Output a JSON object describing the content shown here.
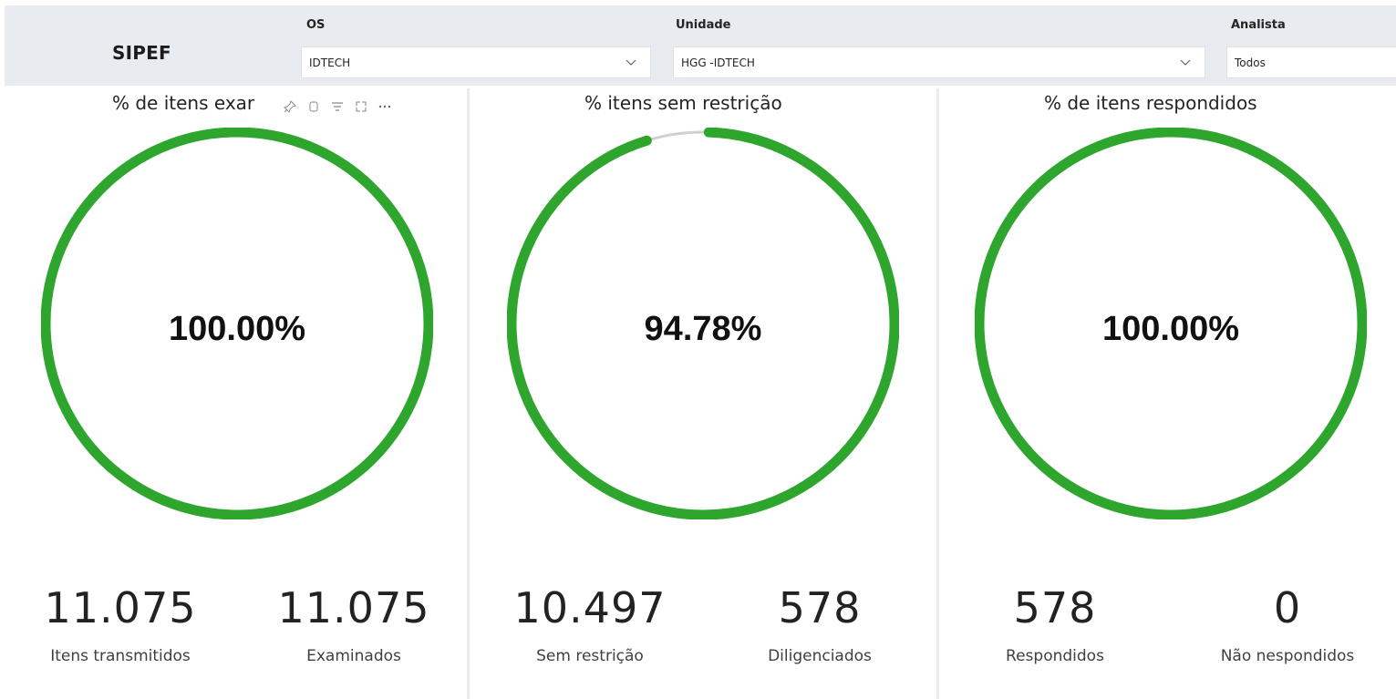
{
  "brand": "SIPEF",
  "filters": {
    "os": {
      "label": "OS",
      "value": "IDTECH"
    },
    "unidade": {
      "label": "Unidade",
      "value": "HGG -IDTECH"
    },
    "analista": {
      "label": "Analista",
      "value": "Todos"
    }
  },
  "cards": [
    {
      "title": "% de itens exar",
      "value_text": "100.00%",
      "fraction": 1.0,
      "kpis": [
        {
          "value": "11.075",
          "label": "Itens transmitidos"
        },
        {
          "value": "11.075",
          "label": "Examinados"
        }
      ]
    },
    {
      "title": "% itens sem restrição",
      "value_text": "94.78%",
      "fraction": 0.9478,
      "kpis": [
        {
          "value": "10.497",
          "label": "Sem restrição"
        },
        {
          "value": "578",
          "label": "Diligenciados"
        }
      ]
    },
    {
      "title": "% de itens respondidos",
      "value_text": "100.00%",
      "fraction": 1.0,
      "kpis": [
        {
          "value": "578",
          "label": "Respondidos"
        },
        {
          "value": "0",
          "label": "Não nespondidos"
        }
      ]
    }
  ],
  "colors": {
    "gauge_fill": "#2ea62e",
    "gauge_track": "#d0d0d0"
  },
  "visual_header_icons": [
    "pin-icon",
    "copy-icon",
    "filter-icon",
    "focus-mode-icon",
    "more-options-icon"
  ]
}
